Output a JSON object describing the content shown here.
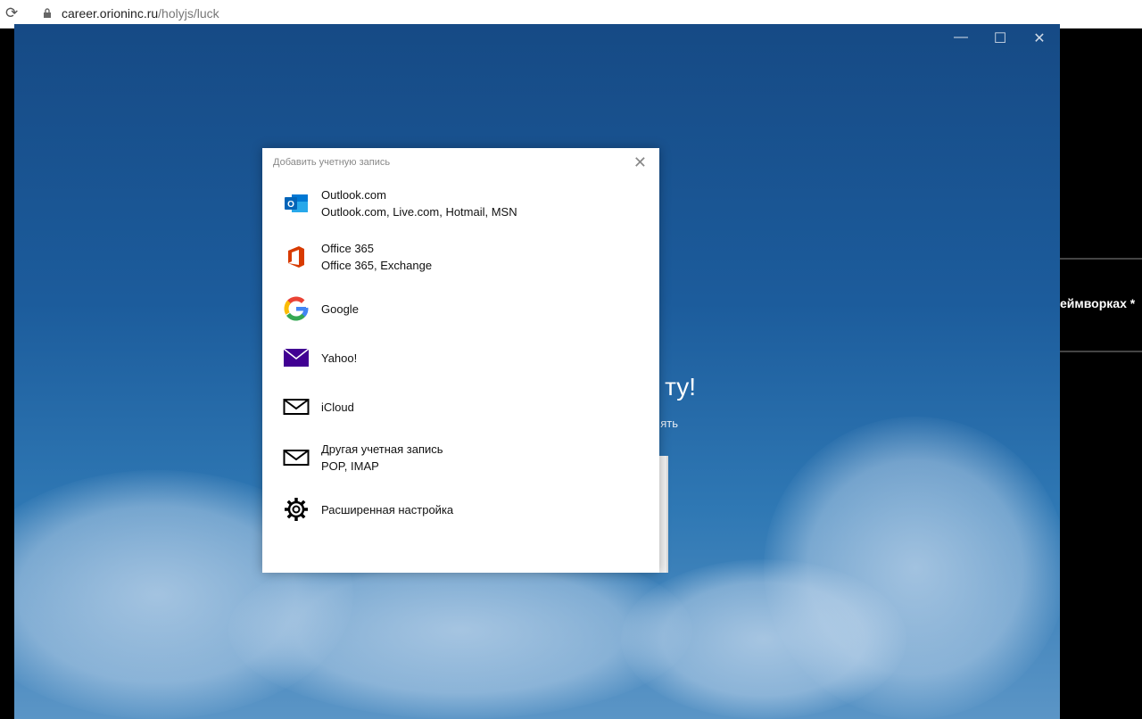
{
  "browser": {
    "url_host": "career.orioninc.ru",
    "url_path": "/holyjs/luck"
  },
  "window": {
    "minimize": "—",
    "maximize": "☐",
    "close": "✕"
  },
  "background": {
    "title_fragment": "ту!",
    "sub_fragment": "ять",
    "right_text": "еймворках *"
  },
  "dialog": {
    "title": "Добавить учетную запись",
    "close": "✕",
    "items": [
      {
        "title": "Outlook.com",
        "subtitle": "Outlook.com, Live.com, Hotmail, MSN",
        "icon": "outlook-icon"
      },
      {
        "title": "Office 365",
        "subtitle": "Office 365, Exchange",
        "icon": "office-icon"
      },
      {
        "title": "Google",
        "icon": "google-icon"
      },
      {
        "title": "Yahoo!",
        "icon": "yahoo-icon"
      },
      {
        "title": "iCloud",
        "icon": "mail-icon"
      },
      {
        "title": "Другая учетная запись",
        "subtitle": "POP, IMAP",
        "icon": "mail-icon"
      },
      {
        "title": "Расширенная настройка",
        "icon": "gear-icon"
      }
    ]
  }
}
